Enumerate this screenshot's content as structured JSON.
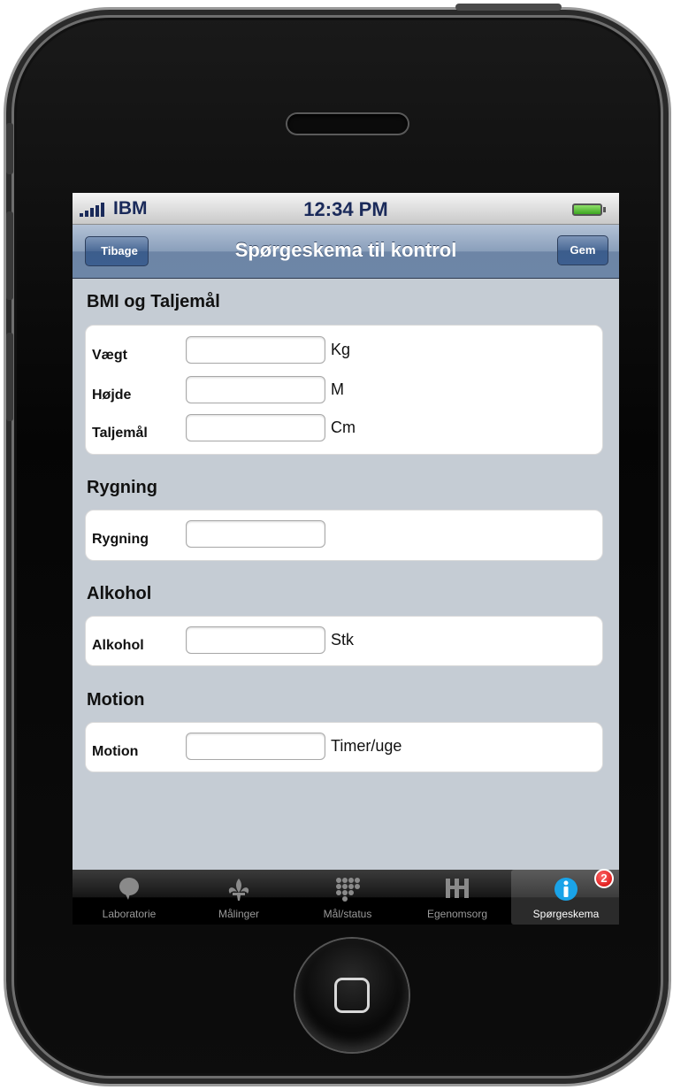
{
  "status_bar": {
    "carrier": "IBM",
    "time": "12:34 PM"
  },
  "nav": {
    "back_label": "Tibage",
    "title": "Spørgeskema til kontrol",
    "save_label": "Gem"
  },
  "sections": [
    {
      "title": "BMI og Taljemål",
      "fields": [
        {
          "label": "Vægt",
          "value": "",
          "unit": "Kg"
        },
        {
          "label": "Højde",
          "value": "",
          "unit": "M"
        },
        {
          "label": "Taljemål",
          "value": "",
          "unit": "Cm"
        }
      ]
    },
    {
      "title": "Rygning",
      "fields": [
        {
          "label": "Rygning",
          "value": "",
          "unit": ""
        }
      ]
    },
    {
      "title": "Alkohol",
      "fields": [
        {
          "label": "Alkohol",
          "value": "",
          "unit": "Stk"
        }
      ]
    },
    {
      "title": "Motion",
      "fields": [
        {
          "label": "Motion",
          "value": "",
          "unit": "Timer/uge"
        }
      ]
    }
  ],
  "tabs": [
    {
      "label": "Laboratorie",
      "icon": "speech-bubble-icon",
      "active": false
    },
    {
      "label": "Målinger",
      "icon": "fleur-de-lis-icon",
      "active": false
    },
    {
      "label": "Mål/status",
      "icon": "grid-dots-icon",
      "active": false
    },
    {
      "label": "Egenomsorg",
      "icon": "tools-icon",
      "active": false
    },
    {
      "label": "Spørgeskema",
      "icon": "info-icon",
      "active": true,
      "badge": "2"
    }
  ],
  "colors": {
    "screen_bg": "#c5ccd4",
    "nav_bar": "#6d86a7",
    "badge": "#d40000",
    "info_icon": "#1aa3e8"
  }
}
